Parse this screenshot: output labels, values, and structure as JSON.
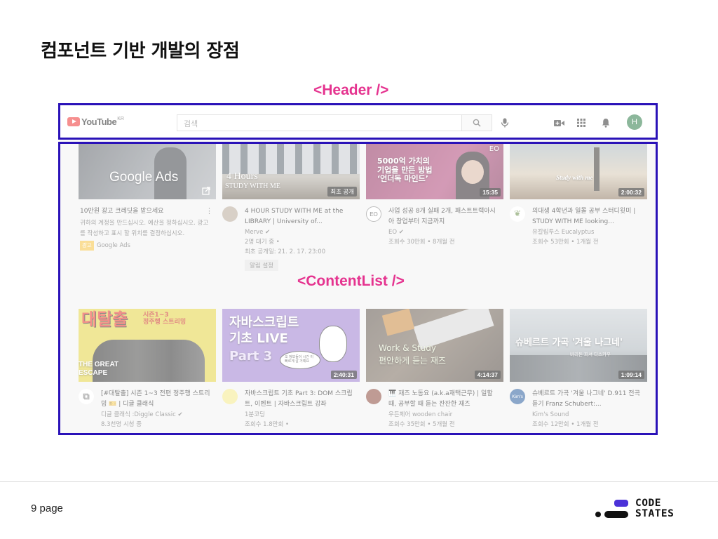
{
  "slide": {
    "title": "컴포넌트 기반 개발의 장점",
    "header_annotation": "<Header />",
    "content_annotation": "<ContentList />",
    "page_label": "9 page",
    "brand_line1": "CODE",
    "brand_line2": "STATES"
  },
  "colors": {
    "annotation_text": "#e5338f",
    "annotation_box": "#2a12b8",
    "youtube_red": "#e33333"
  },
  "header": {
    "logo_text": "YouTube",
    "logo_region": "KR",
    "search_placeholder": "검색",
    "icons": [
      "search-icon",
      "microphone-icon",
      "create-video-icon",
      "apps-grid-icon",
      "bell-icon"
    ],
    "avatar_letter": "H"
  },
  "videos": [
    {
      "thumb_text": "Google Ads",
      "title": "10만원 광고 크레딧을 받으세요",
      "desc": "귀하의 계정을 만드십시오. 예산을 정하십시오. 광고를 작성하고 표시 할 위치를 결정하십시오.",
      "badge": "광고",
      "channel": "Google Ads"
    },
    {
      "thumb_text": "4 Hours",
      "thumb_text2": "STUDY WITH ME",
      "corner_label": "최초 공개",
      "title": "4 HOUR STUDY WITH ME at the LIBRARY | University of...",
      "channel": "Merve",
      "line1": "2명 대기 중 •",
      "line2": "최초 공개일: 21. 2. 17. 23:00",
      "button": "알림 설정"
    },
    {
      "thumb_text": "5000억 가치의\n기업을 만든 방법\n‘언더독 마인드’",
      "thumb_corner": "EO",
      "duration": "15:35",
      "title": "사업 성공 8개 실패 2개, 패스트트랙아시아 창업부터 지금까지",
      "channel": "EO",
      "stats": "조회수 30만회 • 8개월 전",
      "avatar_text": "EO"
    },
    {
      "thumb_text": "Study with me",
      "duration": "2:00:32",
      "title": "의대생 4학년과 일몰 공부 스터디윗미 | STUDY WITH ME looking...",
      "channel": "유칼립투스 Eucalyptus",
      "stats": "조회수 53만회 • 1개월 전"
    },
    {
      "thumb_text": "대탈출",
      "thumb_text2": "시즌1~3\n정주행 스트리밍",
      "thumb_text3": "THE GREAT ESCAPE",
      "title": "[#대탈출] 시즌 1~3 전편 정주행 스트리밍 🎫 | 디글 클래식",
      "channel": "디글 클래식 :Diggle Classic",
      "stats": "8.3천명 시청 중"
    },
    {
      "thumb_text": "자바스크립트\n기초 LIVE",
      "thumb_text2": "Part 3",
      "bubble": "오 정보들이 시간 이 빠르게 갈 거예요",
      "duration": "2:40:31",
      "title": "자바스크립트 기초 Part 3: DOM 스크립트, 이벤트 | 자바스크립트 강좌",
      "channel": "1분코딩",
      "stats": "조회수 1.8만회 •"
    },
    {
      "thumb_text": "Work & Study",
      "thumb_text2": "편안하게 듣는 재즈",
      "duration": "4:14:37",
      "title": "🎹 재즈 노동요 (a.k.a재택근무) | 일할 때, 공부할 때 듣는 잔잔한 재즈",
      "channel": "우든체어 wooden chair",
      "stats": "조회수 35만회 • 5개월 전"
    },
    {
      "thumb_text": "슈베르트 가곡 '겨울 나그네'",
      "thumb_text2": "바리톤 피셔 디스카우",
      "duration": "1:09:14",
      "title": "슈베르트 가곡 '겨울 나그네' D.911 전곡듣기 Franz Schubert:...",
      "channel": "Kim's Sound",
      "stats": "조회수 12만회 • 1개월 전",
      "avatar_text": "Kim's"
    }
  ]
}
